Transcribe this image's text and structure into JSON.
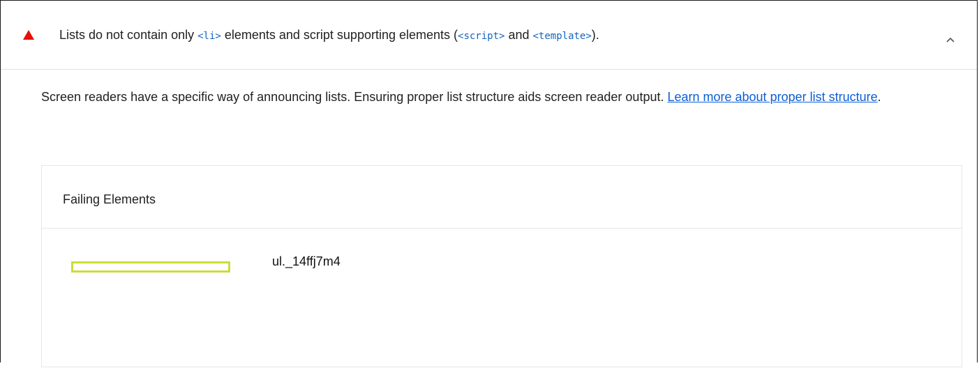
{
  "audit": {
    "title_parts": {
      "t1": "Lists do not contain only ",
      "code1": "<li>",
      "t2": " elements and script supporting elements (",
      "code2": "<script>",
      "t3": " and ",
      "code3": "<template>",
      "t4": ")."
    },
    "icons": {
      "status": "fail-triangle-icon",
      "toggle": "chevron-up-icon"
    },
    "colors": {
      "fail": "#eb0f00",
      "code": "#1565c0",
      "link": "#0b5ed7",
      "highlight": "#cddc39"
    },
    "description": {
      "text": "Screen readers have a specific way of announcing lists. Ensuring proper list structure aids screen reader output. ",
      "link": "Learn more about proper list structure",
      "suffix": "."
    },
    "table": {
      "heading": "Failing Elements",
      "rows": [
        {
          "selector": "ul._14ffj7m4"
        }
      ]
    }
  }
}
